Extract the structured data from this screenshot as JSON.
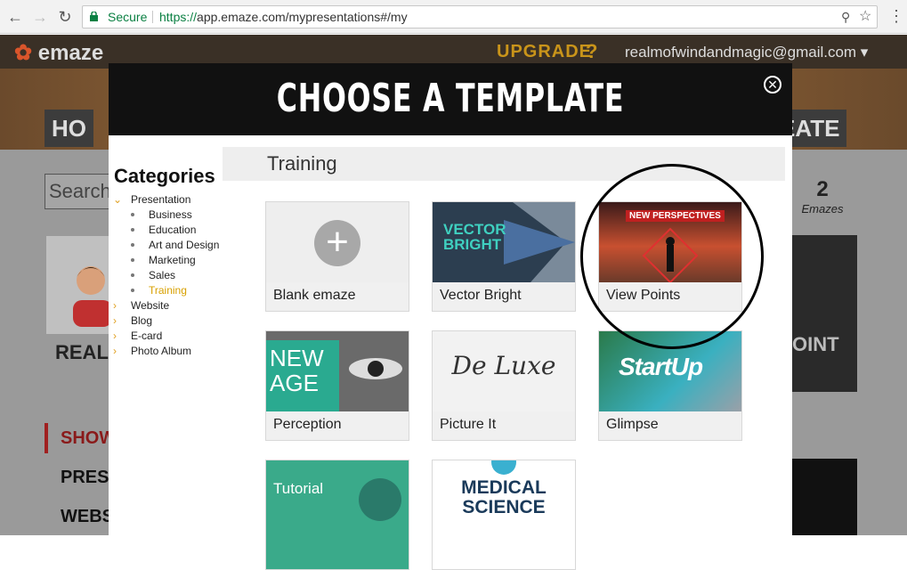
{
  "browser": {
    "secure_label": "Secure",
    "url_scheme": "https://",
    "url_host": "app.emaze.com",
    "url_path": "/mypresentations#/my"
  },
  "site": {
    "logo": "emaze",
    "upgrade": "UPGRADE",
    "help": "?",
    "email": "realmofwindandmagic@gmail.com ▾",
    "hero_left": "HO",
    "hero_right": "EATE",
    "search_placeholder": "Search",
    "username": "REALM",
    "nav_show": "SHOW",
    "nav_present": "PRESEN",
    "nav_website": "WEBSIT",
    "emaze_count": "2",
    "emaze_label": "Emazes",
    "right_panel_text": "OINT"
  },
  "modal": {
    "title": "CHOOSE A TEMPLATE",
    "close": "✕",
    "categories_heading": "Categories",
    "categories": [
      {
        "label": "Presentation",
        "expanded": true
      },
      {
        "label": "Website"
      },
      {
        "label": "Blog"
      },
      {
        "label": "E-card"
      },
      {
        "label": "Photo Album"
      }
    ],
    "subcategories": [
      {
        "label": "Business"
      },
      {
        "label": "Education"
      },
      {
        "label": "Art and Design"
      },
      {
        "label": "Marketing"
      },
      {
        "label": "Sales"
      },
      {
        "label": "Training",
        "active": true
      }
    ],
    "section_title": "Training",
    "templates": [
      {
        "label": "Blank emaze",
        "thumb_text": "+"
      },
      {
        "label": "Vector Bright",
        "thumb_text": "VECTOR BRIGHT"
      },
      {
        "label": "View Points",
        "thumb_text": "NEW PERSPECTIVES"
      },
      {
        "label": "Perception",
        "thumb_text": "NEW AGE"
      },
      {
        "label": "Picture It",
        "thumb_text": "De Luxe"
      },
      {
        "label": "Glimpse",
        "thumb_text": "StartUp"
      },
      {
        "label": "",
        "thumb_text": "Tutorial"
      },
      {
        "label": "",
        "thumb_text": "MEDICAL SCIENCE"
      }
    ]
  },
  "colors": {
    "accent_gold": "#d8a000",
    "modal_header": "#111111",
    "secure_green": "#0b8043"
  }
}
